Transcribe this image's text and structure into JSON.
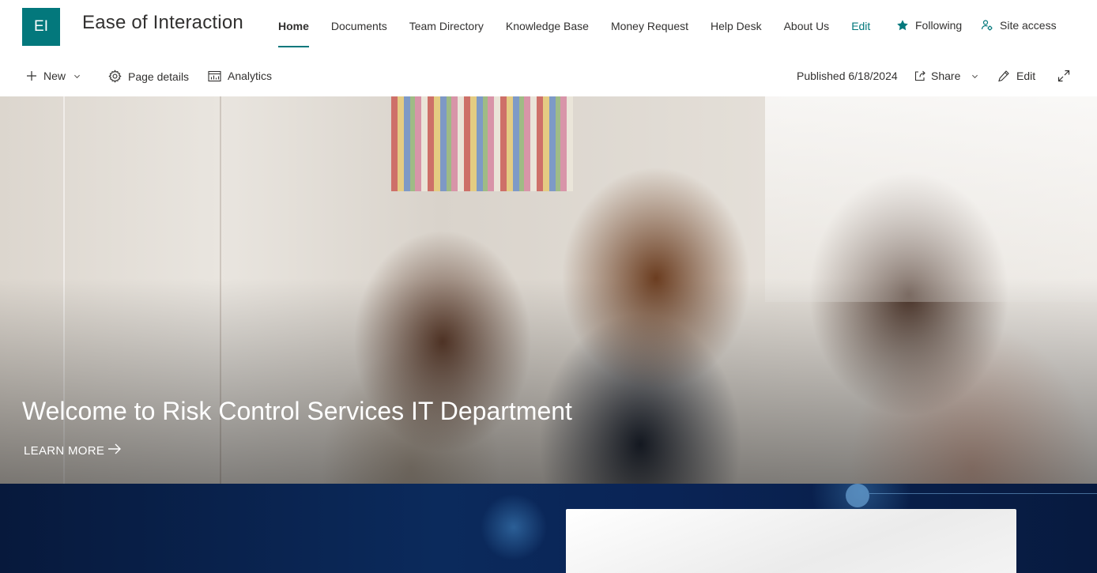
{
  "site": {
    "logo_initials": "EI",
    "title": "Ease of Interaction",
    "accent_color": "#03787c"
  },
  "nav": {
    "items": [
      {
        "label": "Home",
        "active": true
      },
      {
        "label": "Documents"
      },
      {
        "label": "Team Directory"
      },
      {
        "label": "Knowledge Base"
      },
      {
        "label": "Money Request"
      },
      {
        "label": "Help Desk"
      },
      {
        "label": "About Us"
      }
    ],
    "edit_label": "Edit"
  },
  "header_actions": {
    "following_label": "Following",
    "following_icon": "star-filled-icon",
    "site_access_label": "Site access",
    "site_access_icon": "people-settings-icon"
  },
  "command_bar": {
    "new_label": "New",
    "page_details_label": "Page details",
    "analytics_label": "Analytics",
    "published_label": "Published 6/18/2024",
    "share_label": "Share",
    "edit_label": "Edit"
  },
  "hero": {
    "title": "Welcome to Risk Control Services IT Department",
    "link_label": "LEARN MORE"
  }
}
